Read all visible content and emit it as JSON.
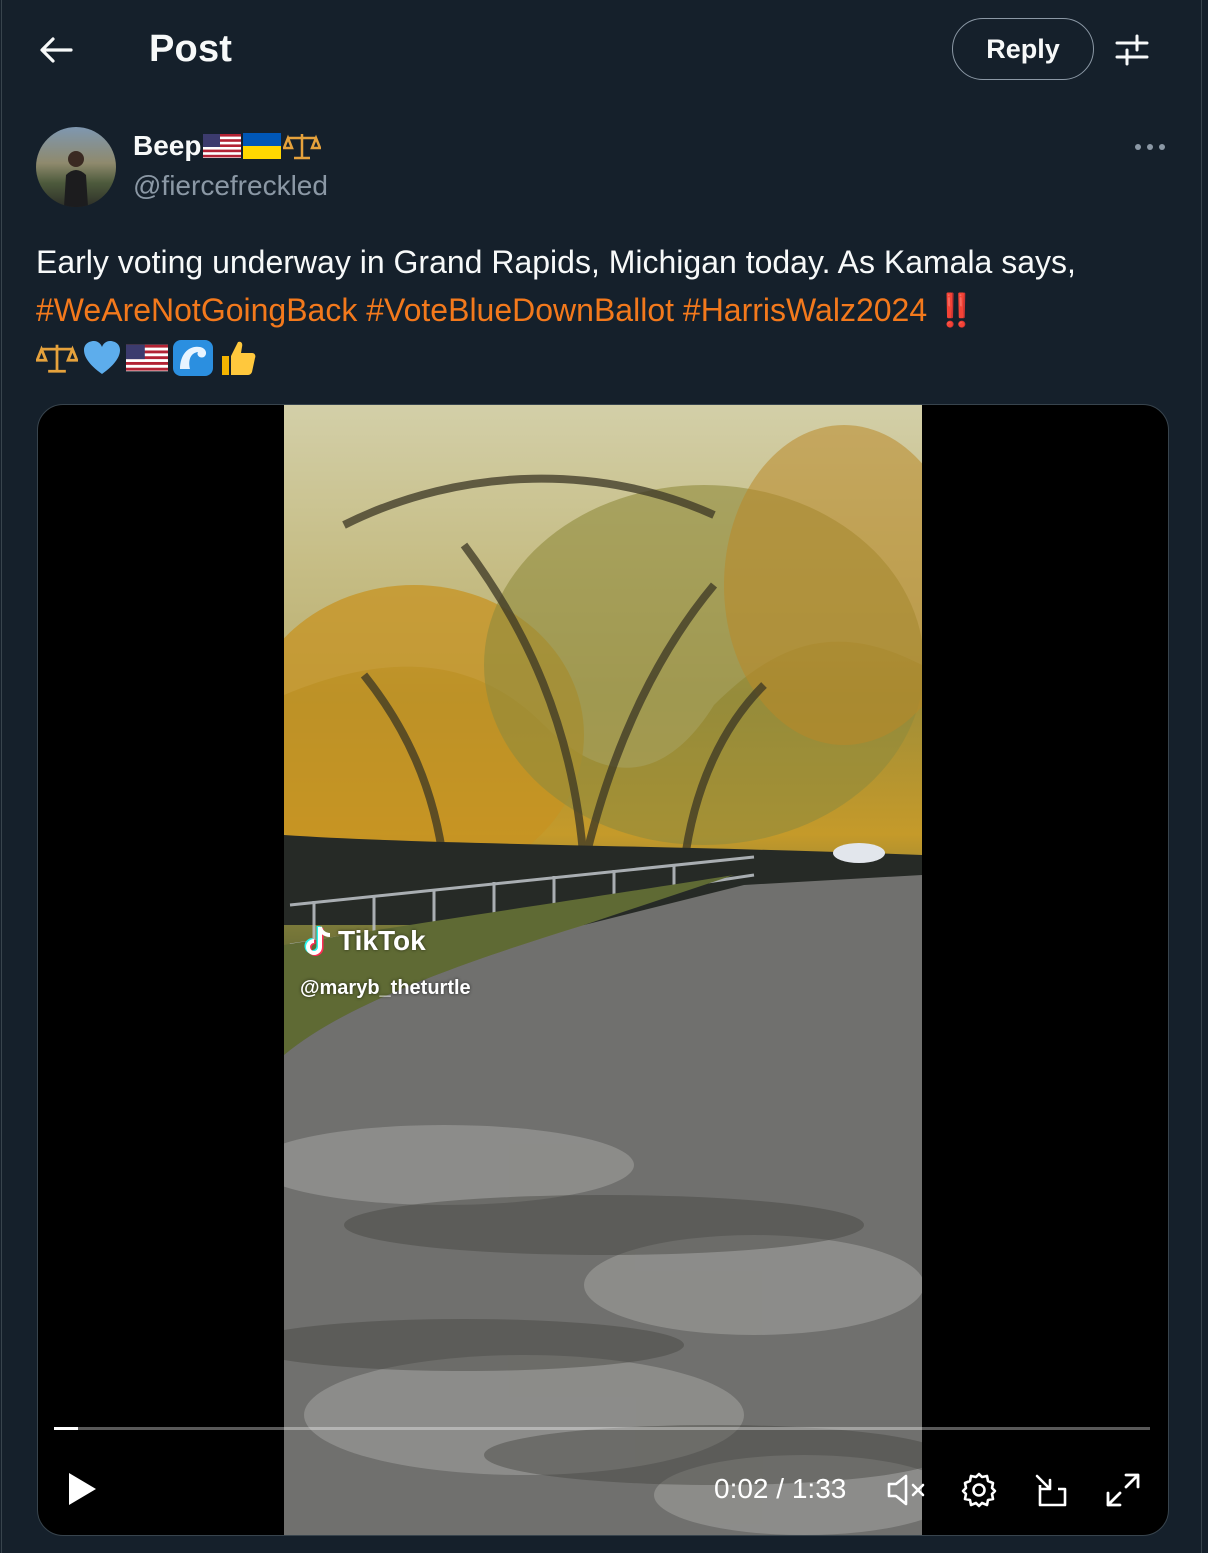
{
  "header": {
    "title": "Post",
    "reply_label": "Reply"
  },
  "author": {
    "name": "Beep",
    "handle": "@fiercefreckled",
    "name_emojis": [
      "us-flag",
      "ukraine-flag",
      "scales"
    ]
  },
  "tweet": {
    "text_line1": "Early voting underway in Grand Rapids, Michigan today.  As Kamala says,",
    "hashtags": [
      "#WeAreNotGoingBack",
      "#VoteBlueDownBallot",
      "#HarrisWalz2024"
    ],
    "trailing": "‼️",
    "emojis": [
      "scales",
      "blue-heart",
      "us-flag",
      "wave",
      "thumbs-up"
    ]
  },
  "video": {
    "watermark_brand": "TikTok",
    "watermark_handle": "@maryb_theturtle",
    "time_current": "0:02",
    "time_separator": "/",
    "time_total": "1:33",
    "progress_fraction": 0.022
  },
  "colors": {
    "background": "#15202b",
    "accent_hashtag": "#f3791c",
    "muted_text": "#8b98a5",
    "border": "#38444d"
  }
}
